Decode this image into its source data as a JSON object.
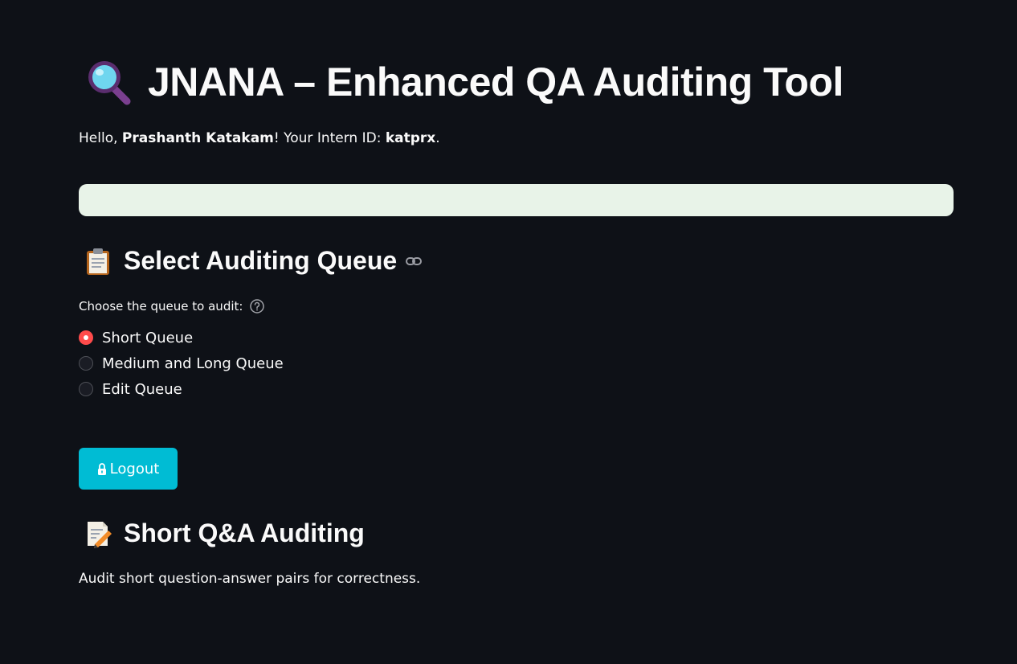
{
  "header": {
    "title": "JNANA – Enhanced QA Auditing Tool",
    "title_icon": "magnifying-glass-icon"
  },
  "greeting": {
    "prefix": "Hello, ",
    "user_name": "Prashanth Katakam",
    "middle": "! Your Intern ID: ",
    "intern_id": "katprx",
    "suffix": "."
  },
  "queue_section": {
    "title": "Select Auditing Queue",
    "icon": "clipboard-icon",
    "radio_label": "Choose the queue to audit:",
    "options": [
      {
        "label": "Short Queue",
        "selected": true
      },
      {
        "label": "Medium and Long Queue",
        "selected": false
      },
      {
        "label": "Edit Queue",
        "selected": false
      }
    ]
  },
  "logout_button": {
    "label": "Logout",
    "icon": "lock-icon"
  },
  "short_section": {
    "title": "Short Q&A Auditing",
    "icon": "memo-icon",
    "description": "Audit short question-answer pairs for correctness."
  },
  "colors": {
    "background": "#0e1117",
    "radio_accent": "#ff4b4b",
    "button": "#00bcd4",
    "info_box": "#e8f3e8"
  }
}
